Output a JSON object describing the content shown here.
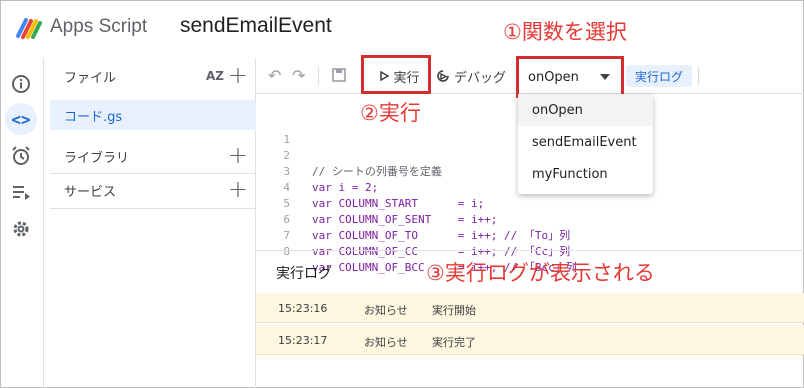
{
  "header": {
    "app_name": "Apps Script",
    "project_name": "sendEmailEvent"
  },
  "rail": {
    "items": [
      {
        "icon": "info-icon"
      },
      {
        "icon": "code-icon",
        "active": true
      },
      {
        "icon": "alarm-icon"
      },
      {
        "icon": "executions-icon"
      },
      {
        "icon": "gear-icon"
      }
    ]
  },
  "sidebar": {
    "files_label": "ファイル",
    "sort_label": "AZ",
    "file_name": "コード.gs",
    "libraries_label": "ライブラリ",
    "services_label": "サービス"
  },
  "toolbar": {
    "run_label": "実行",
    "debug_label": "デバッグ",
    "selected_function": "onOpen",
    "log_label": "実行ログ"
  },
  "dropdown": {
    "options": [
      "onOpen",
      "sendEmailEvent",
      "myFunction"
    ]
  },
  "editor": {
    "lines": [
      {
        "n": "1",
        "text": ""
      },
      {
        "n": "2",
        "text": "// シートの列番号を定義"
      },
      {
        "n": "3",
        "text": "var i = 2;"
      },
      {
        "n": "4",
        "text": "var COLUMN_START      = i;"
      },
      {
        "n": "5",
        "text": "var COLUMN_OF_SENT    = i++;"
      },
      {
        "n": "6",
        "text": "var COLUMN_OF_TO      = i++; // 「To」列"
      },
      {
        "n": "7",
        "text": "var COLUMN_OF_CC      = i++; // 「Cc」列"
      },
      {
        "n": "8",
        "text": "var COLUMN_OF_BCC     = i++; // 「Bcc」列"
      }
    ]
  },
  "annotations": {
    "step1": "①関数を選択",
    "step2": "②実行",
    "step3": "③実行ログが表示される"
  },
  "log": {
    "title": "実行ログ",
    "rows": [
      {
        "time": "15:23:16",
        "level": "お知らせ",
        "message": "実行開始"
      },
      {
        "time": "15:23:17",
        "level": "お知らせ",
        "message": "実行完了"
      }
    ]
  },
  "colors": {
    "accent": "#1a73e8",
    "annotation_red": "#e53935",
    "log_bg": "#fef7e0"
  }
}
